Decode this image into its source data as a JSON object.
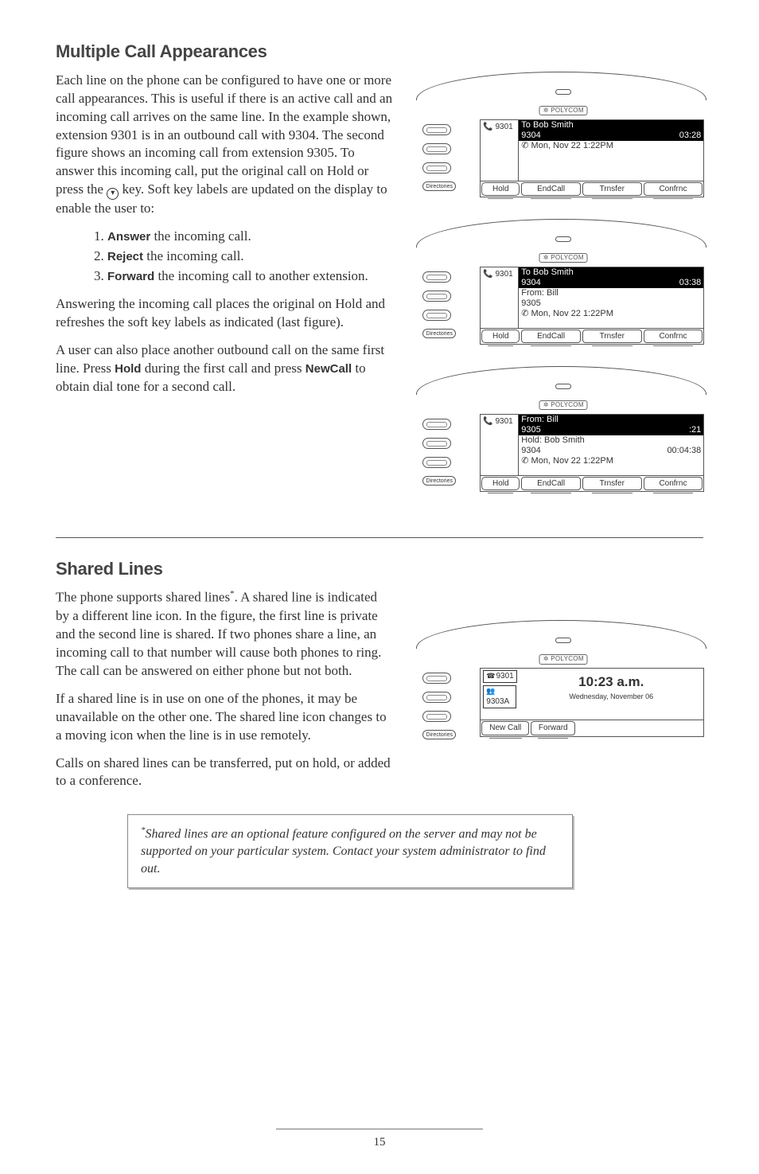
{
  "section1": {
    "heading": "Multiple Call Appearances",
    "p1_a": "Each line on the phone can be configured to have one or more call appearances.  This is useful if there is an active call and an incoming call arrives on the same line.  In the example shown, extension 9301 is in an outbound call with 9304.  The second figure shows an incoming call from extension 9305.  To answer this incoming call, put the original call on Hold or press the ",
    "p1_b": " key. Soft key labels are updated on the display to enable the user to:",
    "li1_pre": "1.  ",
    "li1_bold": "Answer",
    "li1_post": " the incoming call.",
    "li2_pre": "2.  ",
    "li2_bold": "Reject",
    "li2_post": " the incoming call.",
    "li3_pre": "3.  ",
    "li3_bold": "Forward",
    "li3_post": " the incoming call to another extension.",
    "p2": "Answering the incoming call places the original on Hold and refreshes the soft key labels as indicated (last figure).",
    "p3_a": "A user can also place another outbound call on the same first line.  Press ",
    "p3_hold": "Hold",
    "p3_b": " during the first call and press ",
    "p3_newcall": "NewCall",
    "p3_c": " to obtain dial tone for a second call."
  },
  "section2": {
    "heading": "Shared Lines",
    "p1": "The phone supports shared lines",
    "p1b": ".  A shared line is indicated by a different line icon.  In the figure, the first line is private and the second line is shared.  If two phones share a line, an incoming call to that number will cause both phones to ring.  The call can be answered on either phone but not both.",
    "p2": "If a shared line is in use on one of the phones, it may be unavailable on the other one.  The shared line icon changes to a moving icon when the line is in use remotely.",
    "p3": "Calls on shared lines can be transferred, put on hold, or added to a conference."
  },
  "note": {
    "text": "Shared lines are an optional feature configured on the server and may not be supported on your particular system.  Contact your system administrator to find out."
  },
  "logo": "✲ POLYCOM",
  "dir_label": "Directories",
  "phones": [
    {
      "ext": "9301",
      "lines": [
        {
          "cls": "inv",
          "l": "To Bob Smith",
          "r": ""
        },
        {
          "cls": "inv",
          "l": "9304",
          "r": "03:28"
        },
        {
          "cls": "",
          "l": "",
          "r": ""
        },
        {
          "cls": "",
          "l": "",
          "r": ""
        },
        {
          "cls": "",
          "l": "✆ Mon, Nov 22 1:22PM",
          "r": ""
        }
      ],
      "hold": "Hold",
      "sk": [
        "EndCall",
        "Trnsfer",
        "Confrnc"
      ]
    },
    {
      "ext": "9301",
      "lines": [
        {
          "cls": "inv",
          "l": "To Bob Smith",
          "r": ""
        },
        {
          "cls": "inv",
          "l": "9304",
          "r": "03:38"
        },
        {
          "cls": "",
          "l": "From: Bill",
          "r": ""
        },
        {
          "cls": "",
          "l": "9305",
          "r": ""
        },
        {
          "cls": "",
          "l": "✆ Mon, Nov 22 1:22PM",
          "r": ""
        }
      ],
      "hold": "Hold",
      "sk": [
        "EndCall",
        "Trnsfer",
        "Confrnc"
      ]
    },
    {
      "ext": "9301",
      "lines": [
        {
          "cls": "inv",
          "l": "From: Bill",
          "r": ""
        },
        {
          "cls": "inv",
          "l": "9305",
          "r": ":21"
        },
        {
          "cls": "",
          "l": "Hold: Bob Smith",
          "r": ""
        },
        {
          "cls": "",
          "l": "9304",
          "r": "00:04:38"
        },
        {
          "cls": "",
          "l": "✆ Mon, Nov 22 1:22PM",
          "r": ""
        }
      ],
      "hold": "Hold",
      "sk": [
        "EndCall",
        "Trnsfer",
        "Confrnc"
      ]
    }
  ],
  "shared_phone": {
    "ext1": "9301",
    "ext2": "9303A",
    "time": "10:23 a.m.",
    "date": "Wednesday, November 06",
    "sk": [
      "New Call",
      "Forward"
    ]
  },
  "page_num": "15"
}
